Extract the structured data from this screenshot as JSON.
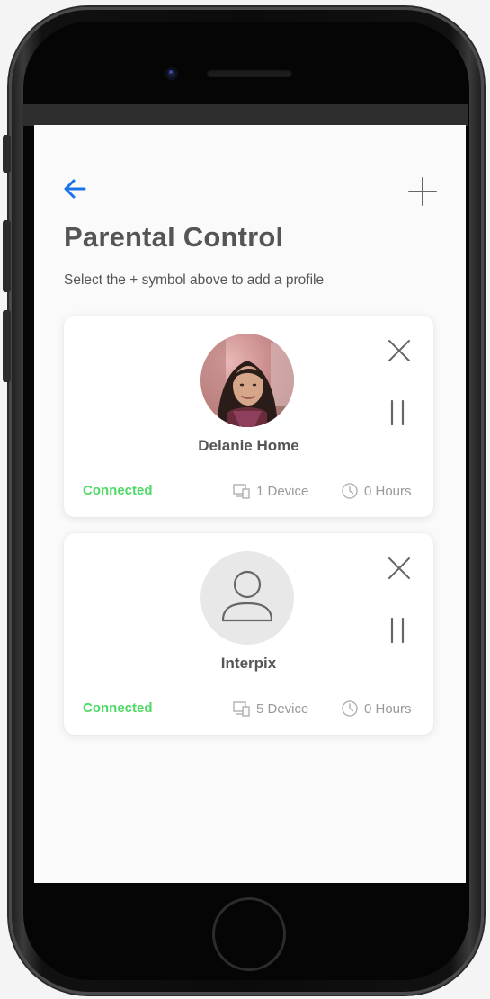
{
  "header": {
    "back_icon": "arrow-left-icon",
    "add_icon": "plus-icon",
    "title": "Parental Control",
    "subtitle": "Select the + symbol above to add a profile"
  },
  "colors": {
    "accent": "#1a73e8",
    "connected": "#4cd964",
    "text_dark": "#555555",
    "text_muted": "#999999"
  },
  "profiles": [
    {
      "name": "Delanie Home",
      "avatar": "photo",
      "status": "Connected",
      "devices": "1 Device",
      "hours": "0 Hours"
    },
    {
      "name": "Interpix",
      "avatar": "user-placeholder-icon",
      "status": "Connected",
      "devices": "5 Device",
      "hours": "0 Hours"
    }
  ]
}
